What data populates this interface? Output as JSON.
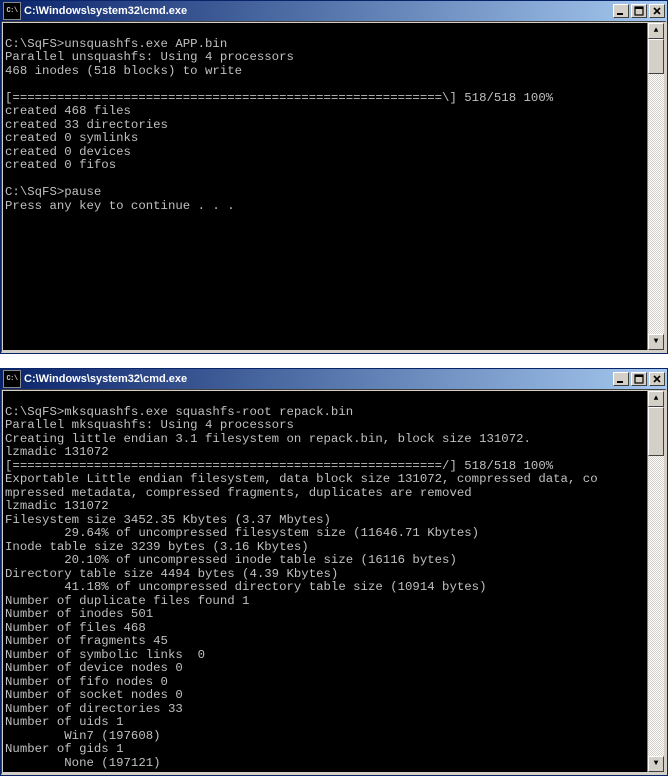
{
  "window1": {
    "title": "C:\\Windows\\system32\\cmd.exe",
    "icon_label": "C:\\",
    "lines": [
      "",
      "C:\\SqFS>unsquashfs.exe APP.bin",
      "Parallel unsquashfs: Using 4 processors",
      "468 inodes (518 blocks) to write",
      "",
      "[==========================================================\\] 518/518 100%",
      "created 468 files",
      "created 33 directories",
      "created 0 symlinks",
      "created 0 devices",
      "created 0 fifos",
      "",
      "C:\\SqFS>pause",
      "Press any key to continue . . .",
      "",
      "",
      "",
      "",
      "",
      "",
      "",
      "",
      "",
      ""
    ],
    "scrollbar_top_pct": 0,
    "scrollbar_height_pct": 12
  },
  "window2": {
    "title": "C:\\Windows\\system32\\cmd.exe",
    "icon_label": "C:\\",
    "lines": [
      "",
      "C:\\SqFS>mksquashfs.exe squashfs-root repack.bin",
      "Parallel mksquashfs: Using 4 processors",
      "Creating little endian 3.1 filesystem on repack.bin, block size 131072.",
      "lzmadic 131072",
      "[==========================================================/] 518/518 100%",
      "Exportable Little endian filesystem, data block size 131072, compressed data, co",
      "mpressed metadata, compressed fragments, duplicates are removed",
      "lzmadic 131072",
      "Filesystem size 3452.35 Kbytes (3.37 Mbytes)",
      "        29.64% of uncompressed filesystem size (11646.71 Kbytes)",
      "Inode table size 3239 bytes (3.16 Kbytes)",
      "        20.10% of uncompressed inode table size (16116 bytes)",
      "Directory table size 4494 bytes (4.39 Kbytes)",
      "        41.18% of uncompressed directory table size (10914 bytes)",
      "Number of duplicate files found 1",
      "Number of inodes 501",
      "Number of files 468",
      "Number of fragments 45",
      "Number of symbolic links  0",
      "Number of device nodes 0",
      "Number of fifo nodes 0",
      "Number of socket nodes 0",
      "Number of directories 33",
      "Number of uids 1",
      "        Win7 (197608)",
      "Number of gids 1",
      "        None (197121)"
    ],
    "scrollbar_top_pct": 0,
    "scrollbar_height_pct": 14
  }
}
